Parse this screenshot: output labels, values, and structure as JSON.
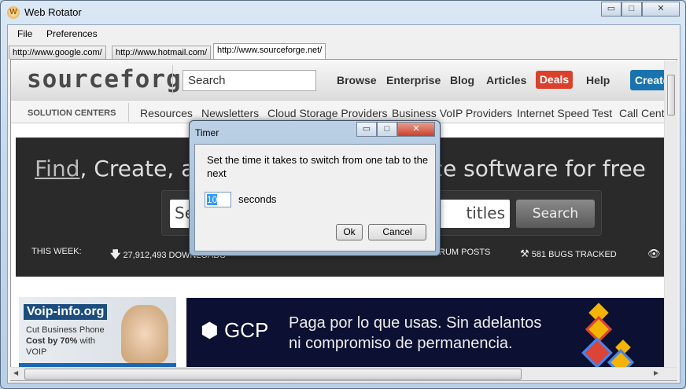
{
  "window": {
    "title": "Web Rotator",
    "min": "▭",
    "max": "□",
    "close": "✕",
    "icon_letter": "W"
  },
  "menu": [
    "File",
    "Preferences"
  ],
  "tabs": [
    "http://www.google.com/",
    "http://www.hotmail.com/",
    "http://www.sourceforge.net/"
  ],
  "site": {
    "logo": "sourceforge",
    "search_placeholder": "Search",
    "nav": [
      "Browse",
      "Enterprise",
      "Blog",
      "Articles"
    ],
    "deals": "Deals",
    "help": "Help",
    "create": "Create",
    "subnav": [
      "SOLUTION CENTERS",
      "Resources",
      "Newsletters",
      "Cloud Storage Providers",
      "Business VoIP Providers",
      "Internet Speed Test",
      "Call Cente"
    ],
    "headline_find": "Find",
    "headline_rest": ", Create, and Publish Open Source software for free",
    "hero_search_left": "Se",
    "hero_search_right": "titles",
    "hero_search_button": "Search",
    "stats_label": "THIS WEEK:",
    "stats": [
      "27,912,493 DOWNLOADS",
      "RUM POSTS",
      "581 BUGS TRACKED"
    ],
    "ad_voip": {
      "brand": "Voip-info.org",
      "line1": "Cut Business Phone",
      "line2_bold": "Cost by 70%",
      "line2": " with",
      "line3": "VOIP"
    },
    "ad_gcp": {
      "brand": "GCP",
      "line1": "Paga por lo que usas. Sin adelantos",
      "line2": "ni compromiso de permanencia."
    }
  },
  "dialog": {
    "title": "Timer",
    "message": "Set the time it takes to switch from one tab to the next",
    "value": "10",
    "unit": "seconds",
    "ok": "Ok",
    "cancel": "Cancel"
  }
}
